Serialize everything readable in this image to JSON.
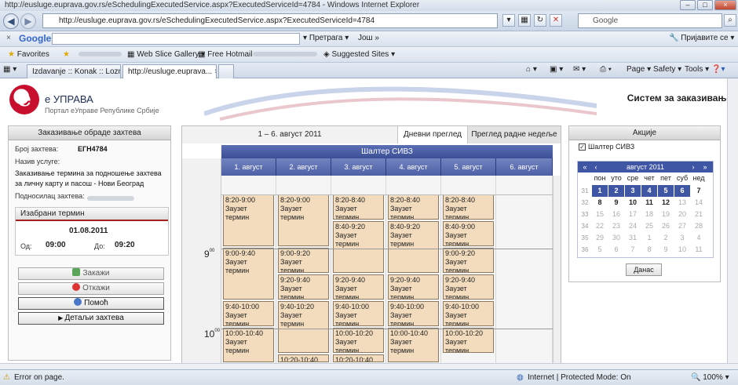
{
  "window": {
    "title": "http://eusluge.eupravа.gov.rs/eSchedulingExecutedService.aspx?ExecutedServiceId=4784 - Windows Internet Explorer",
    "url": "http://eusluge.eupravа.gov.rs/eSchedulingExecutedService.aspx?ExecutedServiceId=4784",
    "search_placeholder": "Google"
  },
  "google_bar": {
    "brand": "Google",
    "search_button": "Претрага",
    "more": "Још »",
    "signin": "Пријавите се"
  },
  "favorites_bar": {
    "favorites": "Favorites",
    "web_slice": "Web Slice Gallery",
    "hotmail": "Free Hotmail",
    "suggested": "Suggested Sites"
  },
  "tabs": [
    {
      "label": "Izdavanje :: Konak :: Loznic..."
    },
    {
      "label": "http://eusluge.euprava..."
    }
  ],
  "command_bar": {
    "page": "Page",
    "safety": "Safety",
    "tools": "Tools"
  },
  "brand": {
    "logo_letter": "e",
    "name": "е УПРАВА",
    "subtitle": "Портал еУправе Републике Србије",
    "system_title": "Систем за заказивање"
  },
  "left_panel": {
    "header": "Заказивање обраде захтева",
    "request_no_label": "Број захтева:",
    "request_no": "ЕГН4784",
    "service_label": "Назив услуге:",
    "service_value": "Заказивање термина за подношење захтева за личну карту и пасош - Нови Београд",
    "applicant_label": "Подносилац захтева:",
    "selected_header": "Изабрани термин",
    "selected_date": "01.08.2011",
    "from_label": "Од:",
    "from_value": "09:00",
    "to_label": "До:",
    "to_value": "09:20",
    "buttons": {
      "book": "Закажи",
      "cancel": "Откажи",
      "help": "Помоћ",
      "details": "Детаљи захтева"
    }
  },
  "scheduler": {
    "range": "1 – 6. август 2011",
    "tab_day": "Дневни преглед",
    "tab_week": "Преглед радне недеље",
    "counter": "Шалтер СИВЗ",
    "days": [
      "1. август",
      "2. август",
      "3. август",
      "4. август",
      "5. август",
      "6. август"
    ],
    "hours": [
      "9",
      "10"
    ],
    "busy_label": "Заузет термин",
    "columns": [
      [
        "8:20-9:00",
        "9:00-9:40",
        "9:40-10:00",
        "10:00-10:40"
      ],
      [
        "8:20-9:00",
        "9:00-9:20",
        "9:20-9:40",
        "9:40-10:20",
        "10:20-10:40"
      ],
      [
        "8:20-8:40",
        "8:40-9:20",
        "9:20-9:40",
        "9:40-10:00",
        "10:00-10:20",
        "10:20-10:40"
      ],
      [
        "8:20-8:40",
        "8:40-9:20",
        "9:20-9:40",
        "9:40-10:00",
        "10:00-10:40"
      ],
      [
        "8:20-8:40",
        "8:40-9:00",
        "9:00-9:20",
        "9:20-9:40",
        "9:40-10:00",
        "10:00-10:20"
      ]
    ]
  },
  "right_panel": {
    "header": "Акције",
    "checkbox_label": "Шалтер СИВЗ",
    "calendar_month": "август 2011",
    "dow": [
      "пон",
      "уто",
      "сре",
      "чет",
      "пет",
      "суб",
      "нед"
    ],
    "weeks": [
      {
        "wk": "31",
        "days": [
          "1",
          "2",
          "3",
          "4",
          "5",
          "6",
          "7"
        ]
      },
      {
        "wk": "32",
        "days": [
          "8",
          "9",
          "10",
          "11",
          "12",
          "13",
          "14"
        ]
      },
      {
        "wk": "33",
        "days": [
          "15",
          "16",
          "17",
          "18",
          "19",
          "20",
          "21"
        ]
      },
      {
        "wk": "34",
        "days": [
          "22",
          "23",
          "24",
          "25",
          "26",
          "27",
          "28"
        ]
      },
      {
        "wk": "35",
        "days": [
          "29",
          "30",
          "31",
          "1",
          "2",
          "3",
          "4"
        ]
      },
      {
        "wk": "36",
        "days": [
          "5",
          "6",
          "7",
          "8",
          "9",
          "10",
          "11"
        ]
      }
    ],
    "today_button": "Данас"
  },
  "status_bar": {
    "left": "Error on page.",
    "zone": "Internet | Protected Mode: On",
    "zoom": "100%"
  },
  "colors": {
    "busy_slot": "#f3dcbd",
    "header_blue": "#3f56a4",
    "brand_red": "#c8102e"
  }
}
